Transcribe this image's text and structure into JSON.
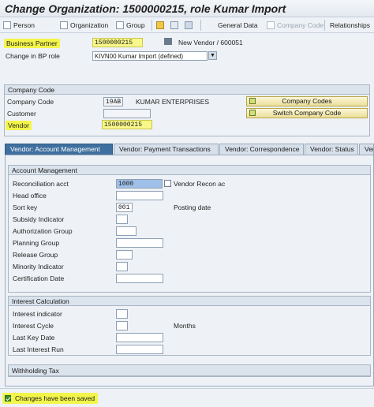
{
  "title": "Change Organization: 1500000215, role Kumar Import",
  "toolbar": {
    "person": "Person",
    "organization": "Organization",
    "group": "Group",
    "general_data": "General Data",
    "company_code": "Company Code",
    "relationships": "Relationships"
  },
  "header": {
    "bp_label": "Business Partner",
    "bp_value": "1500000215",
    "bp_desc": "New Vendor / 600051",
    "role_label": "Change in BP role",
    "role_value": "KIVN00 Kumar Import (defined)"
  },
  "company_code": {
    "group_title": "Company Code",
    "cc_label": "Company Code",
    "cc_value": "19AB",
    "cc_name": "KUMAR ENTERPRISES",
    "customer_label": "Customer",
    "customer_value": "",
    "vendor_label": "Vendor",
    "vendor_value": "1500000215",
    "btn_company_codes": "Company Codes",
    "btn_switch": "Switch Company Code"
  },
  "tabs": [
    {
      "label": "Vendor: Account Management"
    },
    {
      "label": "Vendor: Payment Transactions"
    },
    {
      "label": "Vendor: Correspondence"
    },
    {
      "label": "Vendor: Status"
    },
    {
      "label": "Vend"
    }
  ],
  "account_mgmt": {
    "title": "Account Management",
    "recon_label": "Reconciliation acct",
    "recon_value": "1000",
    "recon_desc": "Vendor Recon ac",
    "head_office_label": "Head office",
    "sort_key_label": "Sort key",
    "sort_key_value": "001",
    "sort_key_desc": "Posting date",
    "subsidy_label": "Subsidy Indicator",
    "auth_label": "Authorization Group",
    "planning_label": "Planning Group",
    "release_label": "Release Group",
    "minority_label": "Minority Indicator",
    "cert_label": "Certification Date"
  },
  "interest": {
    "title": "Interest Calculation",
    "indicator_label": "Interest indicator",
    "cycle_label": "Interest Cycle",
    "cycle_desc": "Months",
    "last_key_label": "Last Key Date",
    "last_run_label": "Last Interest Run"
  },
  "withholding": {
    "title": "Withholding Tax"
  },
  "status": {
    "message": "Changes have been saved"
  }
}
